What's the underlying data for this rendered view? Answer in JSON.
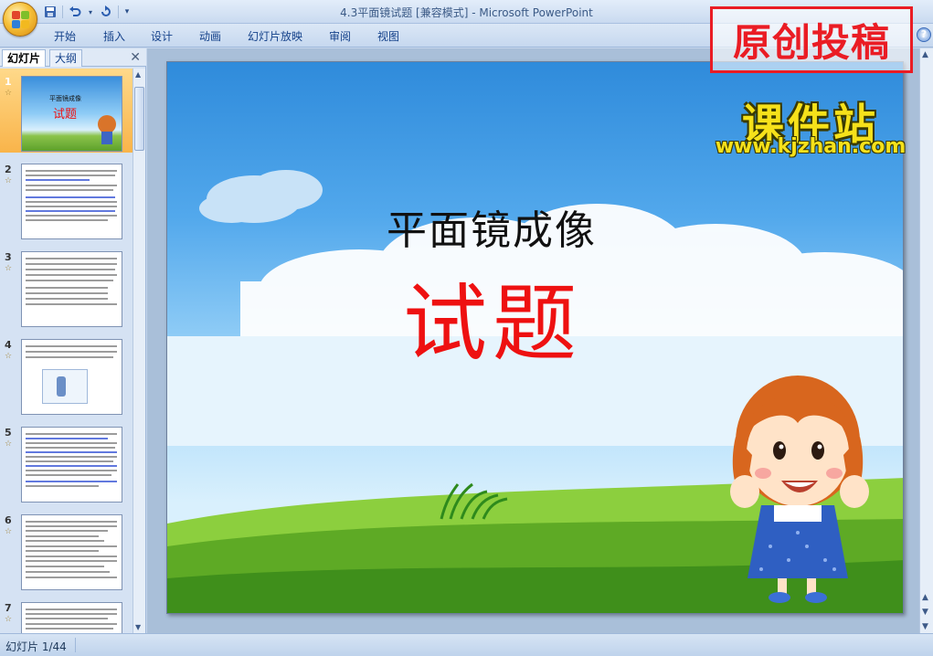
{
  "window": {
    "title": "4.3平面镜试题 [兼容模式] - Microsoft PowerPoint"
  },
  "quick_access": {
    "save_icon": "save-icon",
    "undo_icon": "undo-icon",
    "redo_icon": "redo-icon",
    "customize_icon": "customize-qat-icon"
  },
  "ribbon": {
    "tabs": [
      "开始",
      "插入",
      "设计",
      "动画",
      "幻灯片放映",
      "审阅",
      "视图"
    ],
    "help_icon": "help-icon"
  },
  "watermark": {
    "stamp_text": "原创投稿",
    "logo_cn": "课件站",
    "logo_url": "www.kjzhan.com"
  },
  "left_pane": {
    "tabs": [
      "幻灯片",
      "大纲"
    ],
    "close_label": "✕",
    "thumbnails": [
      {
        "number": "1"
      },
      {
        "number": "2"
      },
      {
        "number": "3"
      },
      {
        "number": "4"
      },
      {
        "number": "5"
      },
      {
        "number": "6"
      },
      {
        "number": "7"
      }
    ],
    "thumb1_title": "平面镜成像",
    "thumb1_subtitle": "试题"
  },
  "slide": {
    "title": "平面镜成像",
    "subtitle": "试题"
  },
  "status_bar": {
    "slide_count": "幻灯片 1/44"
  },
  "colors": {
    "accent_red": "#ea1c24",
    "slide_subtitle_red": "#ee1111",
    "selected_thumb": "#f9b44a"
  }
}
